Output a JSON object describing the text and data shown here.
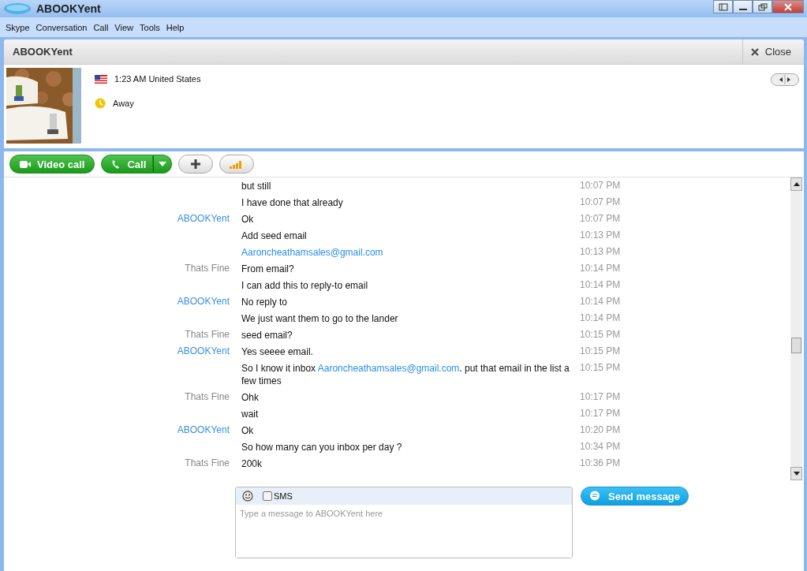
{
  "window": {
    "title": "ABOOKYent"
  },
  "menu": [
    "Skype",
    "Conversation",
    "Call",
    "View",
    "Tools",
    "Help"
  ],
  "contact": {
    "name": "ABOOKYent",
    "close": "Close",
    "local_time": "1:23 AM United States",
    "status": "Away"
  },
  "toolbar": {
    "video_call": "Video call",
    "call": "Call"
  },
  "messages": [
    {
      "parts": [
        {
          "kind": "text",
          "text": "but still"
        }
      ],
      "time": "10:07 PM"
    },
    {
      "parts": [
        {
          "kind": "text",
          "text": "I have done that already"
        }
      ],
      "time": "10:07 PM"
    },
    {
      "sender": "ABOOKYent",
      "color": "#3a8fe0",
      "parts": [
        {
          "kind": "text",
          "text": "Ok"
        }
      ],
      "time": "10:07 PM"
    },
    {
      "parts": [
        {
          "kind": "text",
          "text": "Add seed email"
        }
      ],
      "time": "10:13 PM"
    },
    {
      "parts": [
        {
          "kind": "link",
          "text": "Aaroncheathamsales@gmail.com"
        }
      ],
      "time": "10:13 PM"
    },
    {
      "sender": "Thats Fine",
      "color": "#888888",
      "parts": [
        {
          "kind": "text",
          "text": "From email?"
        }
      ],
      "time": "10:14 PM"
    },
    {
      "parts": [
        {
          "kind": "text",
          "text": "I can add this to reply-to email"
        }
      ],
      "time": "10:14 PM"
    },
    {
      "sender": "ABOOKYent",
      "color": "#3a8fe0",
      "parts": [
        {
          "kind": "text",
          "text": "No reply to"
        }
      ],
      "time": "10:14 PM"
    },
    {
      "parts": [
        {
          "kind": "text",
          "text": "We just want them to go to the lander"
        }
      ],
      "time": "10:14 PM"
    },
    {
      "sender": "Thats Fine",
      "color": "#888888",
      "parts": [
        {
          "kind": "text",
          "text": "seed email?"
        }
      ],
      "time": "10:15 PM"
    },
    {
      "sender": "ABOOKYent",
      "color": "#3a8fe0",
      "parts": [
        {
          "kind": "text",
          "text": "Yes seeee email."
        }
      ],
      "time": "10:15 PM"
    },
    {
      "parts": [
        {
          "kind": "text",
          "text": "So I know it inbox "
        },
        {
          "kind": "link",
          "text": "Aaroncheathamsales@gmail.com"
        },
        {
          "kind": "text",
          "text": ". put that email in the list a few times"
        }
      ],
      "time": "10:15 PM"
    },
    {
      "sender": "Thats Fine",
      "color": "#888888",
      "parts": [
        {
          "kind": "text",
          "text": "Ohk"
        }
      ],
      "time": "10:17 PM"
    },
    {
      "parts": [
        {
          "kind": "text",
          "text": "wait"
        }
      ],
      "time": "10:17 PM"
    },
    {
      "sender": "ABOOKYent",
      "color": "#3a8fe0",
      "parts": [
        {
          "kind": "text",
          "text": "Ok"
        }
      ],
      "time": "10:20 PM"
    },
    {
      "parts": [
        {
          "kind": "text",
          "text": "So how many can you inbox per day ?"
        }
      ],
      "time": "10:34 PM"
    },
    {
      "sender": "Thats Fine",
      "color": "#888888",
      "parts": [
        {
          "kind": "text",
          "text": "200k"
        }
      ],
      "time": "10:36 PM"
    }
  ],
  "composer": {
    "sms_label": "SMS",
    "sms_checked": false,
    "placeholder": "Type a message to ABOOKYent here",
    "send": "Send message"
  }
}
